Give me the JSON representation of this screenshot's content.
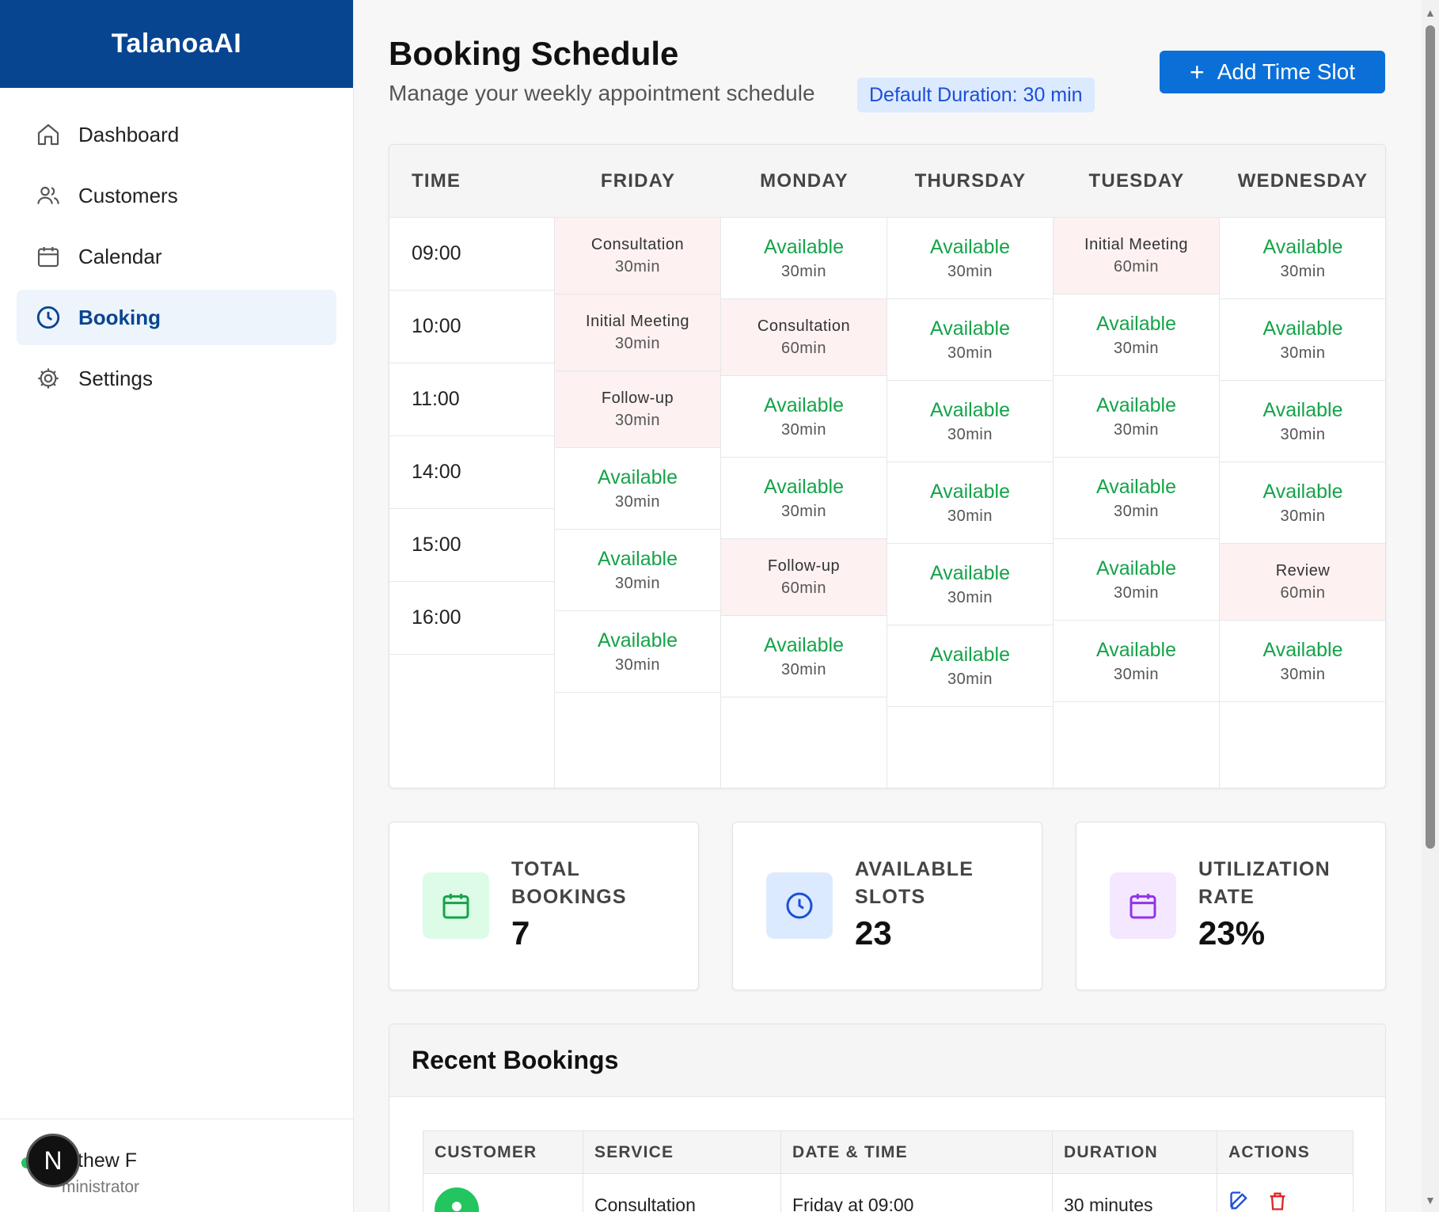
{
  "app": {
    "brand": "TalanoaAI"
  },
  "sidebar": {
    "items": [
      {
        "label": "Dashboard",
        "icon": "home-icon"
      },
      {
        "label": "Customers",
        "icon": "users-icon"
      },
      {
        "label": "Calendar",
        "icon": "calendar-icon"
      },
      {
        "label": "Booking",
        "icon": "clock-icon",
        "active": true
      },
      {
        "label": "Settings",
        "icon": "gear-icon"
      }
    ],
    "user": {
      "name": "thew F",
      "role": "ministrator",
      "badge": "N"
    }
  },
  "header": {
    "title": "Booking Schedule",
    "subtitle": "Manage your weekly appointment schedule",
    "duration_badge": "Default Duration: 30 min",
    "add_button": "Add Time Slot"
  },
  "schedule": {
    "headers": {
      "time": "TIME",
      "days": [
        "FRIDAY",
        "MONDAY",
        "THURSDAY",
        "TUESDAY",
        "WEDNESDAY"
      ]
    },
    "times": [
      "09:00",
      "10:00",
      "11:00",
      "14:00",
      "15:00",
      "16:00"
    ],
    "columns": [
      {
        "slots": [
          {
            "label": "Consultation",
            "duration": "30min",
            "booked": true
          },
          {
            "label": "Initial Meeting",
            "duration": "30min",
            "booked": true
          },
          {
            "label": "Follow-up",
            "duration": "30min",
            "booked": true
          },
          {
            "label": "Available",
            "duration": "30min",
            "booked": false
          },
          {
            "label": "Available",
            "duration": "30min",
            "booked": false
          },
          {
            "label": "Available",
            "duration": "30min",
            "booked": false
          }
        ]
      },
      {
        "slots": [
          {
            "label": "Available",
            "duration": "30min",
            "booked": false
          },
          {
            "label": "Consultation",
            "duration": "60min",
            "booked": true
          },
          {
            "label": "Available",
            "duration": "30min",
            "booked": false
          },
          {
            "label": "Available",
            "duration": "30min",
            "booked": false
          },
          {
            "label": "Follow-up",
            "duration": "60min",
            "booked": true
          },
          {
            "label": "Available",
            "duration": "30min",
            "booked": false
          }
        ]
      },
      {
        "slots": [
          {
            "label": "Available",
            "duration": "30min",
            "booked": false
          },
          {
            "label": "Available",
            "duration": "30min",
            "booked": false
          },
          {
            "label": "Available",
            "duration": "30min",
            "booked": false
          },
          {
            "label": "Available",
            "duration": "30min",
            "booked": false
          },
          {
            "label": "Available",
            "duration": "30min",
            "booked": false
          },
          {
            "label": "Available",
            "duration": "30min",
            "booked": false
          }
        ]
      },
      {
        "slots": [
          {
            "label": "Initial Meeting",
            "duration": "60min",
            "booked": true
          },
          {
            "label": "Available",
            "duration": "30min",
            "booked": false
          },
          {
            "label": "Available",
            "duration": "30min",
            "booked": false
          },
          {
            "label": "Available",
            "duration": "30min",
            "booked": false
          },
          {
            "label": "Available",
            "duration": "30min",
            "booked": false
          },
          {
            "label": "Available",
            "duration": "30min",
            "booked": false
          }
        ]
      },
      {
        "slots": [
          {
            "label": "Available",
            "duration": "30min",
            "booked": false
          },
          {
            "label": "Available",
            "duration": "30min",
            "booked": false
          },
          {
            "label": "Available",
            "duration": "30min",
            "booked": false
          },
          {
            "label": "Available",
            "duration": "30min",
            "booked": false
          },
          {
            "label": "Review",
            "duration": "60min",
            "booked": true
          },
          {
            "label": "Available",
            "duration": "30min",
            "booked": false
          }
        ]
      }
    ]
  },
  "stats": [
    {
      "label": "TOTAL BOOKINGS",
      "value": "7",
      "icon": "calendar-icon",
      "color": "#16a34a",
      "bg": "#dcfce7"
    },
    {
      "label": "AVAILABLE SLOTS",
      "value": "23",
      "icon": "clock-icon",
      "color": "#1d4ed8",
      "bg": "#dbeafe"
    },
    {
      "label": "UTILIZATION RATE",
      "value": "23%",
      "icon": "calendar-icon",
      "color": "#9333ea",
      "bg": "#f3e8ff"
    }
  ],
  "recent": {
    "title": "Recent Bookings",
    "columns": [
      "CUSTOMER",
      "SERVICE",
      "DATE & TIME",
      "DURATION",
      "ACTIONS"
    ],
    "rows": [
      {
        "service": "Consultation",
        "datetime": "Friday at 09:00",
        "duration": "30 minutes"
      }
    ]
  },
  "colors": {
    "brand": "#074591",
    "accent": "#0b6fd8",
    "available": "#16a34a",
    "booked_bg": "#fdf1f1"
  }
}
